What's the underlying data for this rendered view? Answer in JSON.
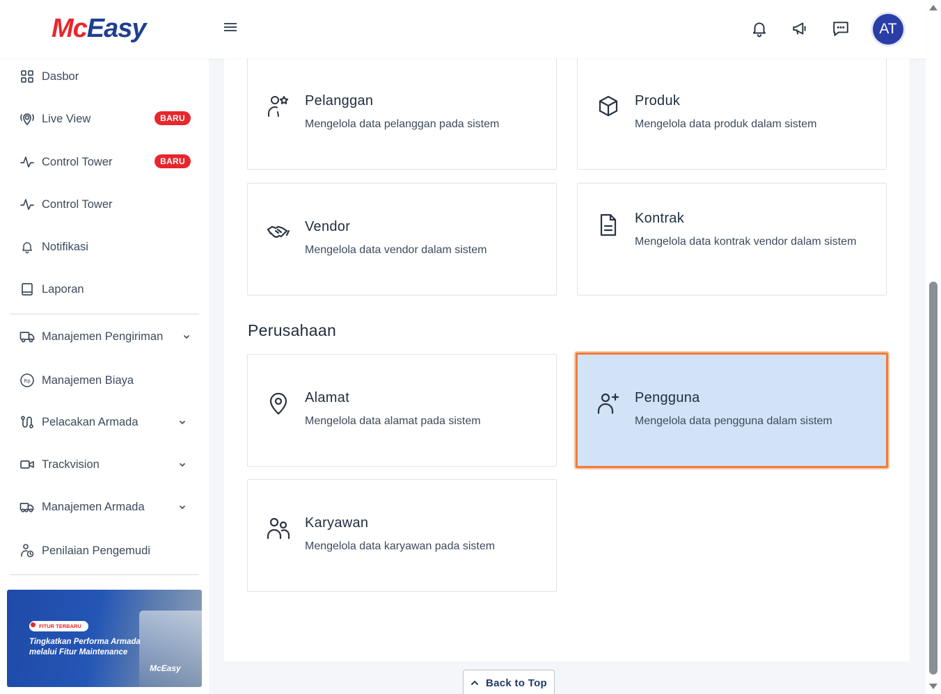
{
  "header": {
    "logo_mc": "Mc",
    "logo_easy": "Easy",
    "avatar_initials": "AT"
  },
  "sidebar": {
    "items": [
      {
        "label": "Dasbor",
        "icon": "dashboard-grid-icon"
      },
      {
        "label": "Live View",
        "icon": "live-location-icon",
        "badge": "BARU"
      },
      {
        "label": "Control Tower",
        "icon": "activity-pulse-icon",
        "badge": "BARU"
      },
      {
        "label": "Control Tower",
        "icon": "activity-pulse-icon"
      },
      {
        "label": "Notifikasi",
        "icon": "bell-icon"
      },
      {
        "label": "Laporan",
        "icon": "book-icon"
      },
      {
        "label": "Manajemen Pengiriman",
        "icon": "truck-icon",
        "expandable": true
      },
      {
        "label": "Manajemen Biaya",
        "icon": "rupiah-coin-icon"
      },
      {
        "label": "Pelacakan Armada",
        "icon": "route-icon",
        "expandable": true
      },
      {
        "label": "Trackvision",
        "icon": "video-camera-icon",
        "expandable": true
      },
      {
        "label": "Manajemen Armada",
        "icon": "fleet-truck-icon",
        "expandable": true
      },
      {
        "label": "Penilaian Pengemudi",
        "icon": "driver-rating-icon"
      }
    ],
    "promo": {
      "tag": "FITUR TERBARU",
      "text": "Tingkatkan Performa Armada melalui Fitur Maintenance",
      "logo": "McEasy"
    }
  },
  "main": {
    "cards_top": [
      {
        "title": "Pelanggan",
        "desc": "Mengelola data pelanggan pada sistem",
        "icon": "customer-star-icon"
      },
      {
        "title": "Produk",
        "desc": "Mengelola data produk dalam sistem",
        "icon": "box-cube-icon"
      },
      {
        "title": "Vendor",
        "desc": "Mengelola data vendor dalam sistem",
        "icon": "handshake-icon"
      },
      {
        "title": "Kontrak",
        "desc": "Mengelola data kontrak vendor dalam sistem",
        "icon": "document-icon"
      }
    ],
    "section_title": "Perusahaan",
    "cards_company": [
      {
        "title": "Alamat",
        "desc": "Mengelola data alamat pada sistem",
        "icon": "map-pin-icon"
      },
      {
        "title": "Pengguna",
        "desc": "Mengelola data pengguna dalam sistem",
        "icon": "user-plus-icon",
        "selected": true
      },
      {
        "title": "Karyawan",
        "desc": "Mengelola data karyawan pada sistem",
        "icon": "users-icon"
      }
    ]
  },
  "back_to_top": "Back to Top",
  "colors": {
    "brand_red": "#e8262d",
    "brand_blue": "#1f3f8f",
    "avatar_bg": "#2a3ea8",
    "selected_bg": "#d2e3f7",
    "selected_border": "#f07d3c"
  }
}
